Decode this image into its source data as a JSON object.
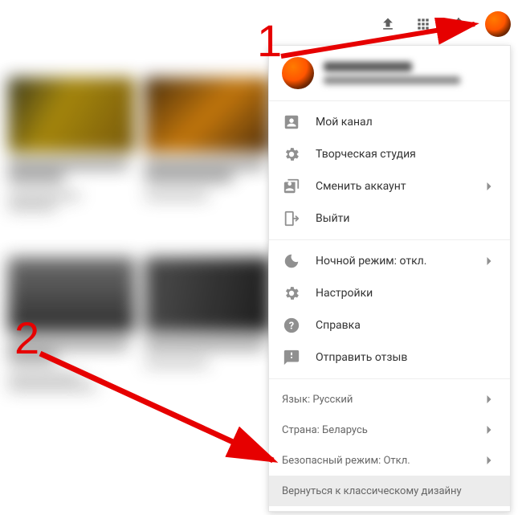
{
  "annotations": {
    "one": "1",
    "two": "2"
  },
  "menu": {
    "section1": [
      {
        "icon": "account-box-icon",
        "label": "Мой канал",
        "chevron": false
      },
      {
        "icon": "studio-gear-icon",
        "label": "Творческая студия",
        "chevron": false
      },
      {
        "icon": "switch-account-icon",
        "label": "Сменить аккаунт",
        "chevron": true
      },
      {
        "icon": "sign-out-icon",
        "label": "Выйти",
        "chevron": false
      }
    ],
    "section2": [
      {
        "icon": "moon-icon",
        "label": "Ночной режим: откл.",
        "chevron": true
      },
      {
        "icon": "settings-gear-icon",
        "label": "Настройки",
        "chevron": false
      },
      {
        "icon": "help-icon",
        "label": "Справка",
        "chevron": false
      },
      {
        "icon": "feedback-icon",
        "label": "Отправить отзыв",
        "chevron": false
      }
    ],
    "section3": [
      {
        "label": "Язык: Русский",
        "chevron": true
      },
      {
        "label": "Страна: Беларусь",
        "chevron": true
      },
      {
        "label": "Безопасный режим: Откл.",
        "chevron": true
      },
      {
        "label": "Вернуться к классическому дизайну",
        "chevron": false,
        "highlight": true
      }
    ]
  }
}
